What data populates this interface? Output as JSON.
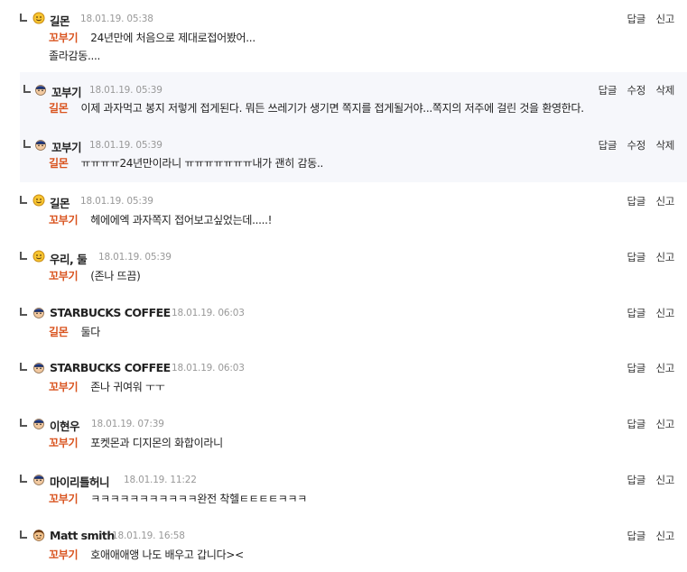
{
  "actions": {
    "reply": "답글",
    "report": "신고",
    "edit": "수정",
    "delete": "삭제"
  },
  "comments": [
    {
      "nick": "길몬",
      "date": "18.01.19. 05:38",
      "mention": "꼬부기",
      "text": "24년만에 처음으로 제대로접어봤어...",
      "text2": "졸라감동....",
      "avatar": "smiley-icon"
    },
    {
      "nick": "꼬부기",
      "date": "18.01.19. 05:39",
      "mention": "길몬",
      "text": "이제 과자먹고 봉지 저렇게 접게된다. 뭐든 쓰레기가 생기면 쪽지를 접게될거야...쪽지의 저주에 걸린 것을 환영한다.",
      "avatar": "police-icon"
    },
    {
      "nick": "꼬부기",
      "date": "18.01.19. 05:39",
      "mention": "길몬",
      "text": "ㅠㅠㅠㅠ24년만이라니 ㅠㅠㅠㅠㅠㅠㅠ내가 괜히 감동..",
      "avatar": "police-icon"
    },
    {
      "nick": "길몬",
      "date": "18.01.19. 05:39",
      "mention": "꼬부기",
      "text": "헤에에엑 과자쪽지 접어보고싶었는데.....!",
      "avatar": "smiley-icon"
    },
    {
      "nick": "우리, 둘",
      "date": "18.01.19. 05:39",
      "mention": "꼬부기",
      "text": "(존나 뜨끔)",
      "avatar": "smiley-icon"
    },
    {
      "nick": "STARBUCKS COFFEE",
      "date": "18.01.19. 06:03",
      "mention": "길몬",
      "text": "둘다",
      "avatar": "police-icon"
    },
    {
      "nick": "STARBUCKS COFFEE",
      "date": "18.01.19. 06:03",
      "mention": "꼬부기",
      "text": "존나 귀여워 ㅜㅜ",
      "avatar": "police-icon"
    },
    {
      "nick": "이현우",
      "date": "18.01.19. 07:39",
      "mention": "꼬부기",
      "text": "포켓몬과 디지몬의 화합이라니",
      "avatar": "police-icon"
    },
    {
      "nick": "마이리틀허니",
      "date": "18.01.19. 11:22",
      "mention": "꼬부기",
      "text": "ㅋㅋㅋㅋㅋㅋㅋㅋㅋㅋㅋ완전 착헬ㅌㅌㅌㅌㅋㅋㅋ",
      "avatar": "police-icon"
    },
    {
      "nick": "Matt smith",
      "date": "18.01.19. 16:58",
      "mention": "꼬부기",
      "text": "호애애애앵 나도 배우고 갑니다><",
      "avatar": "man-icon"
    }
  ]
}
